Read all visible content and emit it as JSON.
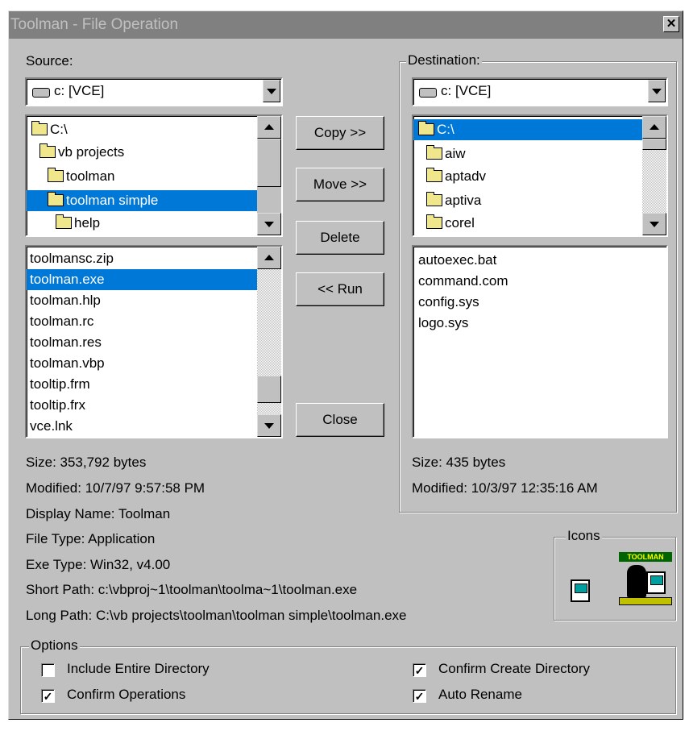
{
  "window": {
    "title": "Toolman - File Operation",
    "close_glyph": "✕"
  },
  "source": {
    "label": "Source:",
    "drive": "c: [VCE]",
    "folders": [
      "C:\\",
      "vb projects",
      "toolman",
      "toolman simple",
      "help"
    ],
    "files": [
      "toolmansc.zip",
      "toolman.exe",
      "toolman.hlp",
      "toolman.rc",
      "toolman.res",
      "toolman.vbp",
      "tooltip.frm",
      "tooltip.frx",
      "vce.lnk"
    ],
    "size": "Size: 353,792 bytes",
    "modified": "Modified: 10/7/97 9:57:58 PM",
    "display_name": "Display Name: Toolman",
    "file_type": "File Type: Application",
    "exe_type": "Exe Type: Win32, v4.00",
    "short_path": "Short Path: c:\\vbproj~1\\toolman\\toolma~1\\toolman.exe",
    "long_path": "Long Path: C:\\vb projects\\toolman\\toolman simple\\toolman.exe"
  },
  "destination": {
    "label": "Destination:",
    "drive": "c: [VCE]",
    "folders": [
      "C:\\",
      "aiw",
      "aptadv",
      "aptiva",
      "corel"
    ],
    "files": [
      "autoexec.bat",
      "command.com",
      "config.sys",
      "logo.sys"
    ],
    "size": "Size: 435 bytes",
    "modified": "Modified: 10/3/97 12:35:16 AM"
  },
  "buttons": {
    "copy": "Copy >>",
    "move": "Move >>",
    "delete": "Delete",
    "run": "<< Run",
    "close": "Close"
  },
  "icons": {
    "label": "Icons",
    "badge": "TOOLMAN"
  },
  "options": {
    "label": "Options",
    "include_entire_directory": "Include Entire Directory",
    "confirm_operations": "Confirm Operations",
    "confirm_create_directory": "Confirm Create Directory",
    "auto_rename": "Auto Rename",
    "states": {
      "include_entire_directory": false,
      "confirm_operations": true,
      "confirm_create_directory": true,
      "auto_rename": true
    },
    "check_glyph": "✓"
  },
  "colors": {
    "selection": "#0078d7",
    "face": "#c0c0c0"
  }
}
